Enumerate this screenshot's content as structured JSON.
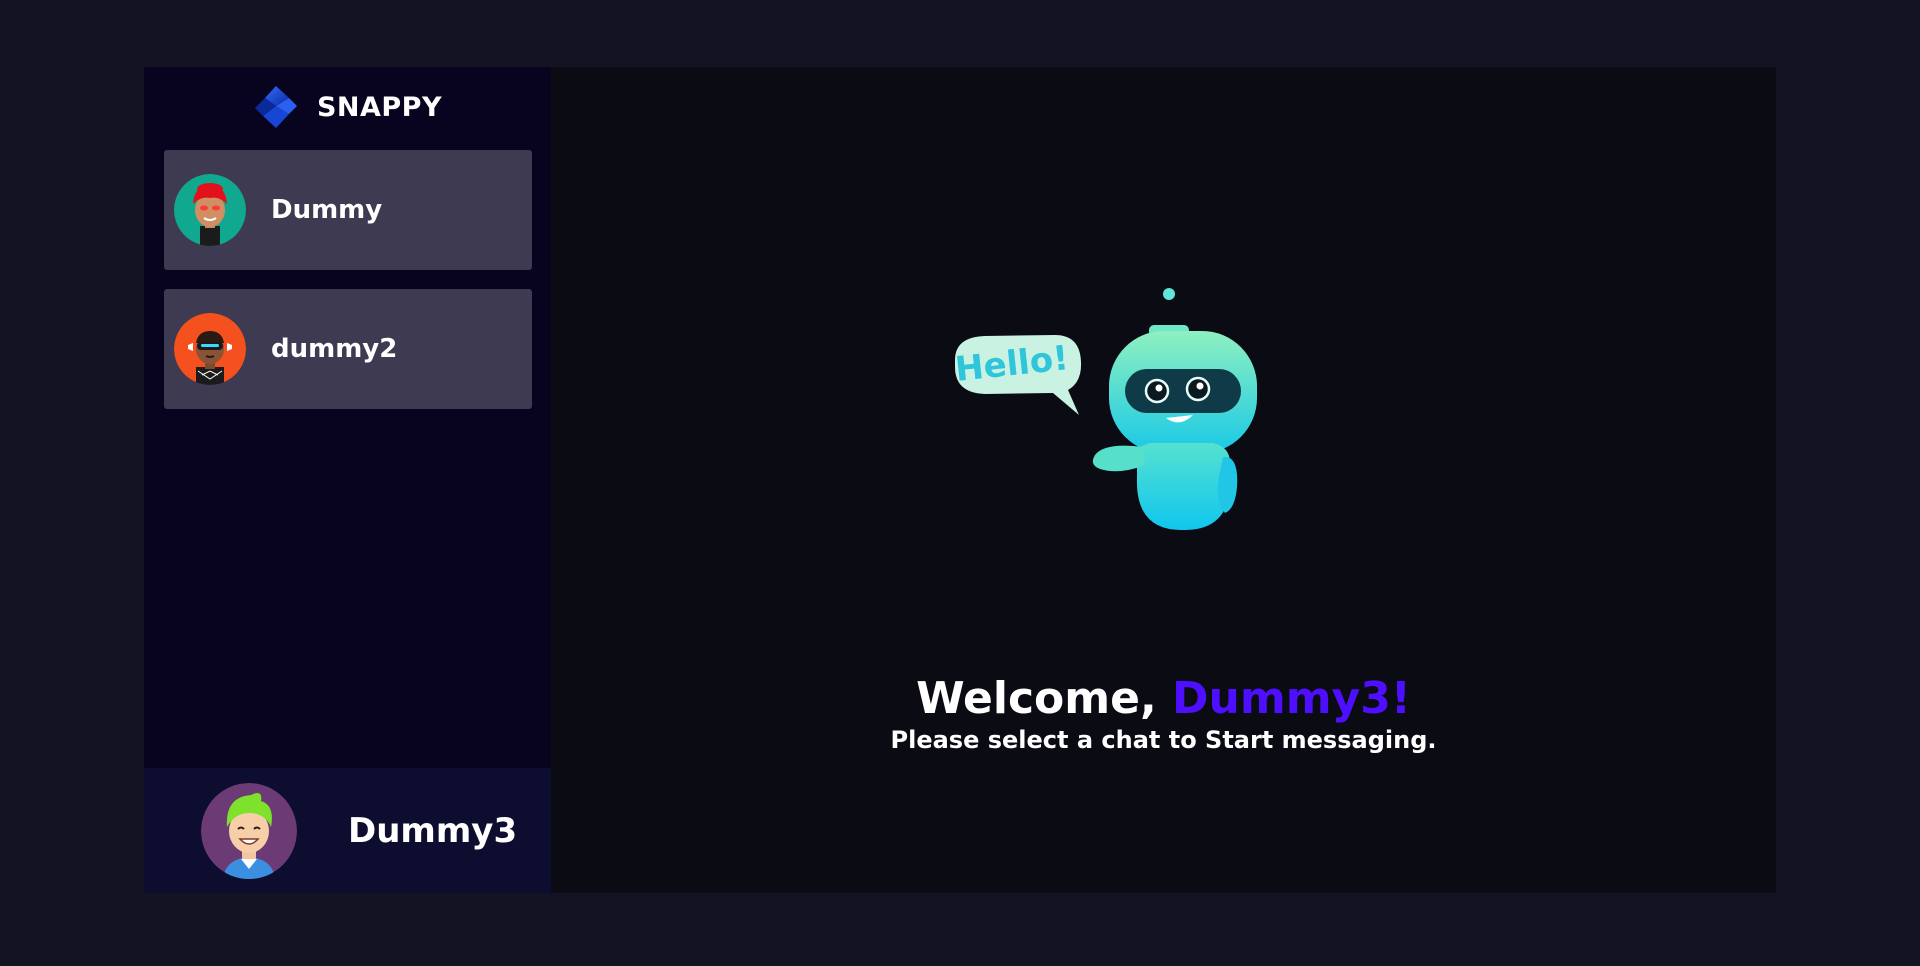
{
  "brand": {
    "name": "SNAPPY",
    "logo_icon": "snappy-logo-icon"
  },
  "contacts": [
    {
      "username": "Dummy",
      "avatar_icon": "avatar-red-hair-icon"
    },
    {
      "username": "dummy2",
      "avatar_icon": "avatar-visor-icon"
    }
  ],
  "current_user": {
    "username": "Dummy3",
    "avatar_icon": "avatar-green-hair-icon"
  },
  "welcome": {
    "greeting": "Welcome, ",
    "username": "Dummy3!",
    "subtitle": "Please select a chat to Start messaging.",
    "robot_speech": "Hello!"
  },
  "colors": {
    "page_background": "#131324",
    "sidebar_background": "#080420",
    "contact_background": "#3e3a51",
    "current_user_background": "#0d0d30",
    "accent": "#4e0eff"
  }
}
